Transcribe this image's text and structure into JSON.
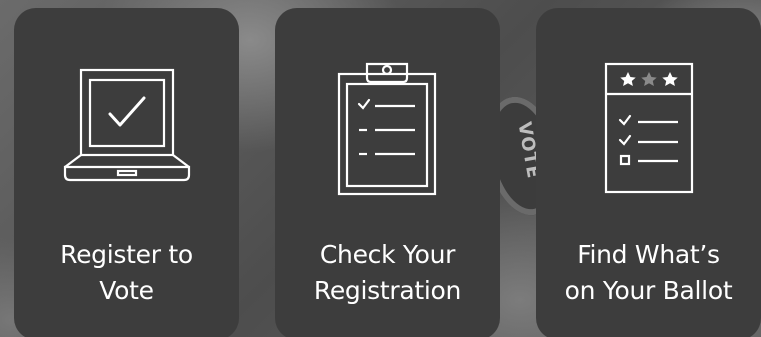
{
  "cards": [
    {
      "icon": "laptop-checkmark-icon",
      "line1": "Register to",
      "line2": "Vote"
    },
    {
      "icon": "clipboard-checklist-icon",
      "line1": "Check Your",
      "line2": "Registration"
    },
    {
      "icon": "ballot-stars-checklist-icon",
      "line1": "Find What’s",
      "line2": "on Your Ballot"
    }
  ],
  "background": {
    "badge_text": "VOTE"
  },
  "colors": {
    "card": "#3d3d3d",
    "text": "#ffffff",
    "background": "#5a5a5a"
  }
}
